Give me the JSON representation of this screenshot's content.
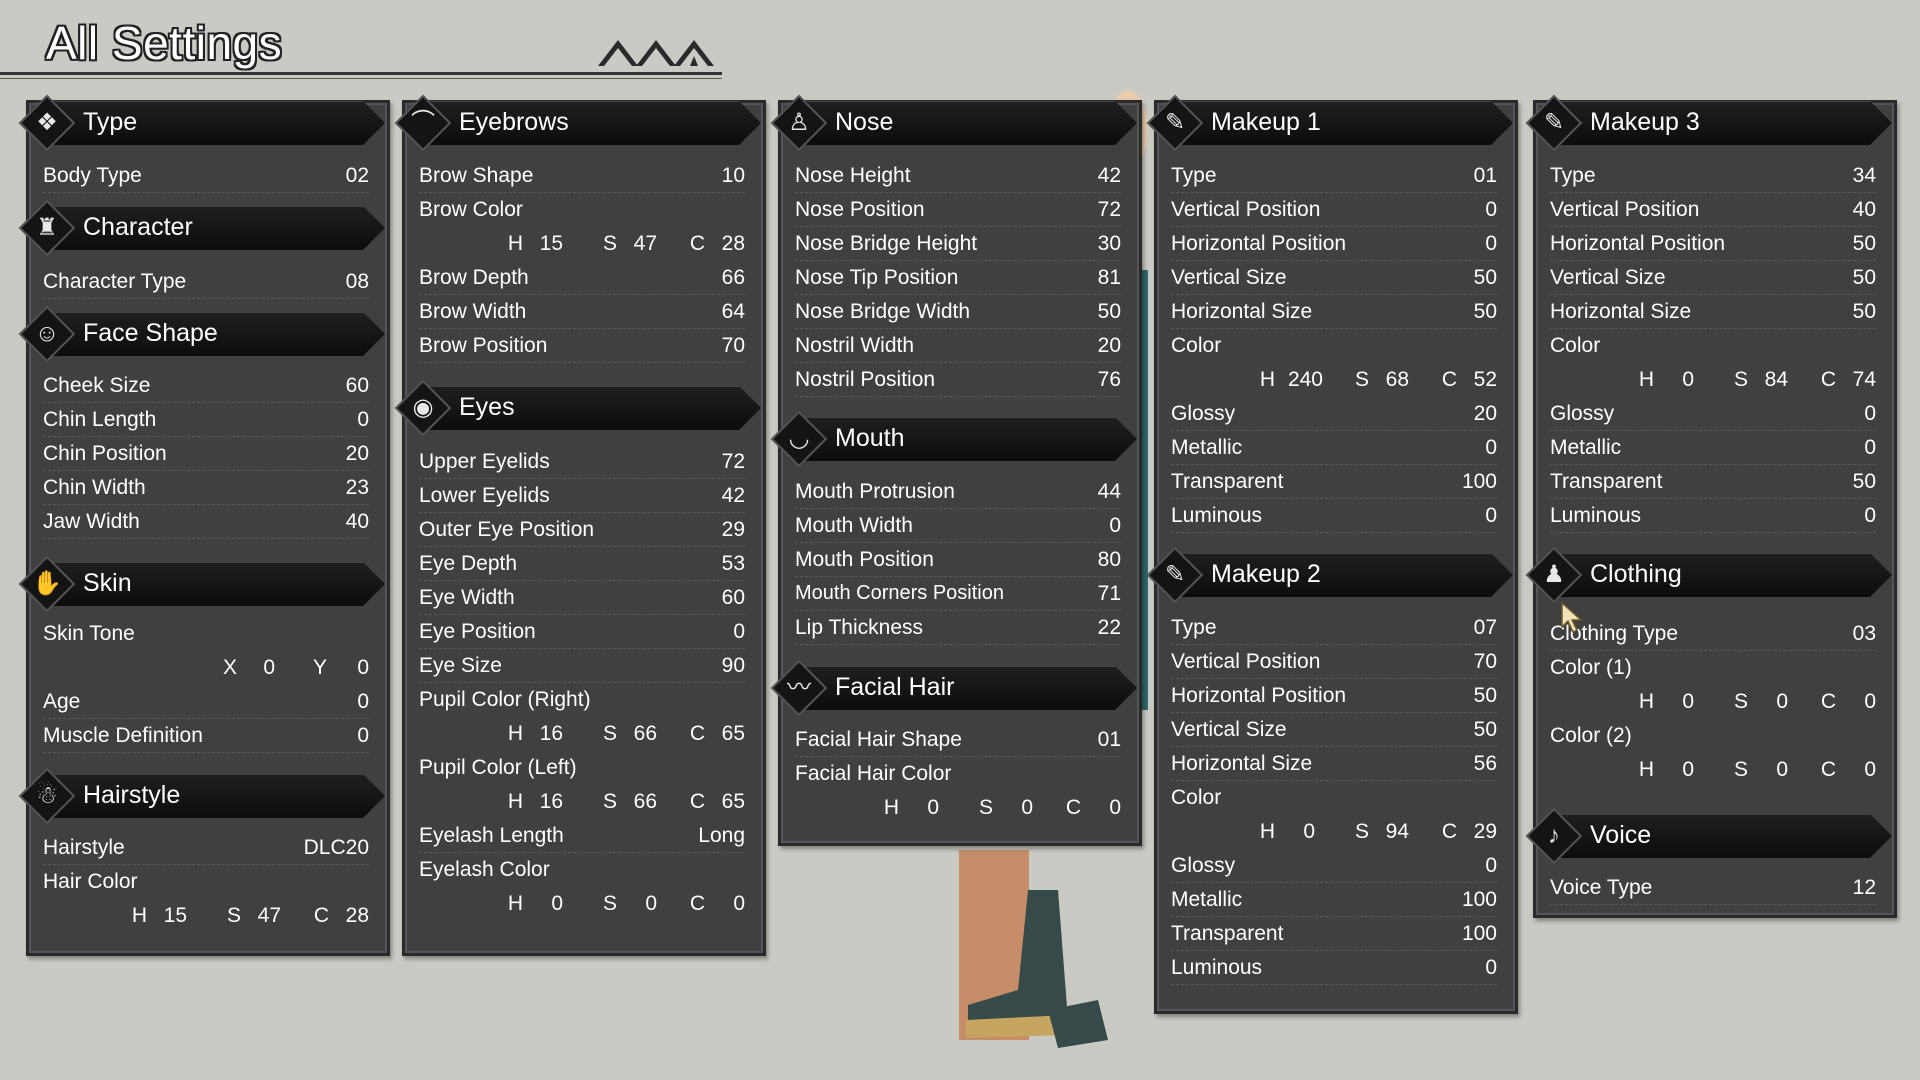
{
  "title": "All Settings",
  "panels": {
    "type": {
      "header": "Type",
      "body_type_label": "Body Type",
      "body_type_value": "02"
    },
    "character": {
      "header": "Character",
      "label": "Character Type",
      "value": "08"
    },
    "face_shape": {
      "header": "Face Shape",
      "rows": [
        {
          "label": "Cheek Size",
          "value": "60"
        },
        {
          "label": "Chin Length",
          "value": "0"
        },
        {
          "label": "Chin Position",
          "value": "20"
        },
        {
          "label": "Chin Width",
          "value": "23"
        },
        {
          "label": "Jaw Width",
          "value": "40"
        }
      ]
    },
    "skin": {
      "header": "Skin",
      "tone_label": "Skin Tone",
      "tone": {
        "x_label": "X",
        "x": "0",
        "y_label": "Y",
        "y": "0"
      },
      "rows": [
        {
          "label": "Age",
          "value": "0"
        },
        {
          "label": "Muscle Definition",
          "value": "0"
        }
      ]
    },
    "hairstyle": {
      "header": "Hairstyle",
      "style_label": "Hairstyle",
      "style_value": "DLC20",
      "color_label": "Hair Color",
      "color": {
        "h": "15",
        "s": "47",
        "c": "28"
      }
    },
    "eyebrows": {
      "header": "Eyebrows",
      "shape_label": "Brow Shape",
      "shape_value": "10",
      "color_label": "Brow Color",
      "color": {
        "h": "15",
        "s": "47",
        "c": "28"
      },
      "rows": [
        {
          "label": "Brow Depth",
          "value": "66"
        },
        {
          "label": "Brow Width",
          "value": "64"
        },
        {
          "label": "Brow Position",
          "value": "70"
        }
      ]
    },
    "eyes": {
      "header": "Eyes",
      "rows": [
        {
          "label": "Upper Eyelids",
          "value": "72"
        },
        {
          "label": "Lower Eyelids",
          "value": "42"
        },
        {
          "label": "Outer Eye Position",
          "value": "29"
        },
        {
          "label": "Eye Depth",
          "value": "53"
        },
        {
          "label": "Eye Width",
          "value": "60"
        },
        {
          "label": "Eye Position",
          "value": "0"
        },
        {
          "label": "Eye Size",
          "value": "90"
        }
      ],
      "pupil_right_label": "Pupil Color (Right)",
      "pupil_right": {
        "h": "16",
        "s": "66",
        "c": "65"
      },
      "pupil_left_label": "Pupil Color (Left)",
      "pupil_left": {
        "h": "16",
        "s": "66",
        "c": "65"
      },
      "lash_length_label": "Eyelash Length",
      "lash_length_value": "Long",
      "lash_color_label": "Eyelash Color",
      "lash_color": {
        "h": "0",
        "s": "0",
        "c": "0"
      }
    },
    "nose": {
      "header": "Nose",
      "rows": [
        {
          "label": "Nose Height",
          "value": "42"
        },
        {
          "label": "Nose Position",
          "value": "72"
        },
        {
          "label": "Nose Bridge Height",
          "value": "30"
        },
        {
          "label": "Nose Tip Position",
          "value": "81"
        },
        {
          "label": "Nose Bridge Width",
          "value": "50"
        },
        {
          "label": "Nostril Width",
          "value": "20"
        },
        {
          "label": "Nostril Position",
          "value": "76"
        }
      ]
    },
    "mouth": {
      "header": "Mouth",
      "rows": [
        {
          "label": "Mouth Protrusion",
          "value": "44"
        },
        {
          "label": "Mouth Width",
          "value": "0"
        },
        {
          "label": "Mouth Position",
          "value": "80"
        },
        {
          "label": "Mouth Corners Position",
          "value": "71"
        },
        {
          "label": "Lip Thickness",
          "value": "22"
        }
      ]
    },
    "facial_hair": {
      "header": "Facial Hair",
      "shape_label": "Facial Hair Shape",
      "shape_value": "01",
      "color_label": "Facial Hair Color",
      "color": {
        "h": "0",
        "s": "0",
        "c": "0"
      }
    },
    "makeup1": {
      "header": "Makeup 1",
      "rows": [
        {
          "label": "Type",
          "value": "01"
        },
        {
          "label": "Vertical Position",
          "value": "0"
        },
        {
          "label": "Horizontal Position",
          "value": "0"
        },
        {
          "label": "Vertical Size",
          "value": "50"
        },
        {
          "label": "Horizontal Size",
          "value": "50"
        }
      ],
      "color_label": "Color",
      "color": {
        "h": "240",
        "s": "68",
        "c": "52"
      },
      "rows2": [
        {
          "label": "Glossy",
          "value": "20"
        },
        {
          "label": "Metallic",
          "value": "0"
        },
        {
          "label": "Transparent",
          "value": "100"
        },
        {
          "label": "Luminous",
          "value": "0"
        }
      ]
    },
    "makeup2": {
      "header": "Makeup 2",
      "rows": [
        {
          "label": "Type",
          "value": "07"
        },
        {
          "label": "Vertical Position",
          "value": "70"
        },
        {
          "label": "Horizontal Position",
          "value": "50"
        },
        {
          "label": "Vertical Size",
          "value": "50"
        },
        {
          "label": "Horizontal Size",
          "value": "56"
        }
      ],
      "color_label": "Color",
      "color": {
        "h": "0",
        "s": "94",
        "c": "29"
      },
      "rows2": [
        {
          "label": "Glossy",
          "value": "0"
        },
        {
          "label": "Metallic",
          "value": "100"
        },
        {
          "label": "Transparent",
          "value": "100"
        },
        {
          "label": "Luminous",
          "value": "0"
        }
      ]
    },
    "makeup3": {
      "header": "Makeup 3",
      "rows": [
        {
          "label": "Type",
          "value": "34"
        },
        {
          "label": "Vertical Position",
          "value": "40"
        },
        {
          "label": "Horizontal Position",
          "value": "50"
        },
        {
          "label": "Vertical Size",
          "value": "50"
        },
        {
          "label": "Horizontal Size",
          "value": "50"
        }
      ],
      "color_label": "Color",
      "color": {
        "h": "0",
        "s": "84",
        "c": "74"
      },
      "rows2": [
        {
          "label": "Glossy",
          "value": "0"
        },
        {
          "label": "Metallic",
          "value": "0"
        },
        {
          "label": "Transparent",
          "value": "50"
        },
        {
          "label": "Luminous",
          "value": "0"
        }
      ]
    },
    "clothing": {
      "header": "Clothing",
      "type_label": "Clothing Type",
      "type_value": "03",
      "color1_label": "Color (1)",
      "color1": {
        "h": "0",
        "s": "0",
        "c": "0"
      },
      "color2_label": "Color (2)",
      "color2": {
        "h": "0",
        "s": "0",
        "c": "0"
      }
    },
    "voice": {
      "header": "Voice",
      "label": "Voice Type",
      "value": "12"
    }
  },
  "hsc_letters": {
    "h": "H",
    "s": "S",
    "c": "C"
  },
  "colors": {
    "background": "#c9cac3",
    "panel": "#404040",
    "header": "#111111",
    "text": "#ffffff"
  }
}
